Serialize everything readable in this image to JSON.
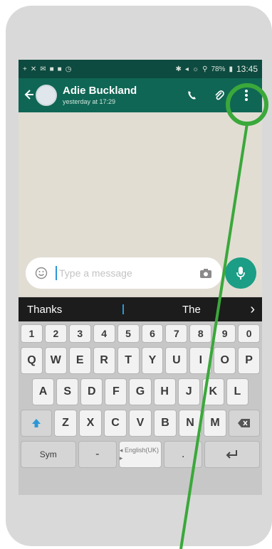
{
  "contact": {
    "name": "Adie Buckland",
    "status": "yesterday at 17:29"
  },
  "statusbar": {
    "left_icons": [
      "+",
      "✕",
      "✉",
      "■",
      "■",
      "◷"
    ],
    "right_icons": [
      "✱",
      "◂",
      "☼",
      "⚲"
    ],
    "battery": "78%",
    "time": "13:45"
  },
  "input": {
    "placeholder": "Type a message"
  },
  "suggestions": {
    "left": "Thanks",
    "right": "The"
  },
  "keyboard": {
    "numbers": [
      "1",
      "2",
      "3",
      "4",
      "5",
      "6",
      "7",
      "8",
      "9",
      "0"
    ],
    "row1": [
      "Q",
      "W",
      "E",
      "R",
      "T",
      "Y",
      "U",
      "I",
      "O",
      "P"
    ],
    "row2": [
      "A",
      "S",
      "D",
      "F",
      "G",
      "H",
      "J",
      "K",
      "L"
    ],
    "row3": [
      "Z",
      "X",
      "C",
      "V",
      "B",
      "N",
      "M"
    ],
    "sym_label": "Sym",
    "dash": "-",
    "dot": ".",
    "space_label": "◂ English(UK) ▸"
  },
  "colors": {
    "header": "#0f6654",
    "statusbar": "#0d4a3f",
    "mic": "#1b9e85",
    "annotation": "#3aa83a"
  }
}
